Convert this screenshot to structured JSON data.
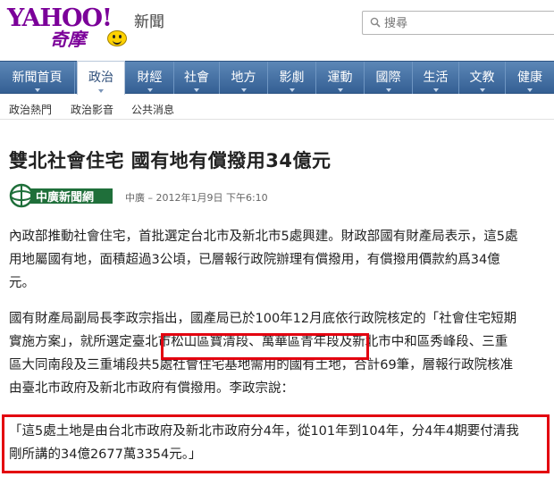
{
  "header": {
    "logo_yahoo": "YAHOO!",
    "logo_kimo": "奇摩",
    "section": "新聞"
  },
  "search": {
    "placeholder": "搜尋"
  },
  "nav": {
    "tabs": [
      {
        "label": "新聞首頁",
        "active": false
      },
      {
        "label": "政治",
        "active": true
      },
      {
        "label": "財經",
        "active": false
      },
      {
        "label": "社會",
        "active": false
      },
      {
        "label": "地方",
        "active": false
      },
      {
        "label": "影劇",
        "active": false
      },
      {
        "label": "運動",
        "active": false
      },
      {
        "label": "國際",
        "active": false
      },
      {
        "label": "生活",
        "active": false
      },
      {
        "label": "文教",
        "active": false
      },
      {
        "label": "健康",
        "active": false
      }
    ]
  },
  "subnav": {
    "items": [
      "政治熱門",
      "政治影音",
      "公共消息"
    ]
  },
  "article": {
    "title": "雙北社會住宅 國有地有償撥用34億元",
    "source_logo_text": "中廣新聞網",
    "byline": "中廣 – 2012年1月9日 下午6:10",
    "p1_lines": [
      "內政部推動社會住宅，首批選定台北市及新北市5處興建。財政部國有財產局表示，這5處",
      "用地屬國有地，面積超過3公頃，已層報行政院辦理有償撥用，有償撥用價款約爲34億",
      "元。"
    ],
    "p2_lines": [
      "國有財產局副局長李政宗指出，國產局已於100年12月底依行政院核定的「社會住宅短期",
      "實施方案」，就所選定臺北市松山區寶清段、萬華區青年段及新北市中和區秀峰段、三重",
      "區大同南段及三重埔段共5處社會住宅基地需用的國有土地，合計69筆，層報行政院核准",
      "由臺北市政府及新北市政府有償撥用。李政宗說："
    ],
    "p3_lines": [
      "「這5處土地是由台北市政府及新北市政府分4年，從101年到104年，分4年4期要付清我",
      "剛所講的34億2677萬3354元。」"
    ]
  },
  "colors": {
    "nav_bg": "#3f6aa0",
    "logo_purple": "#7b0099",
    "highlight_red": "#e3000f"
  }
}
